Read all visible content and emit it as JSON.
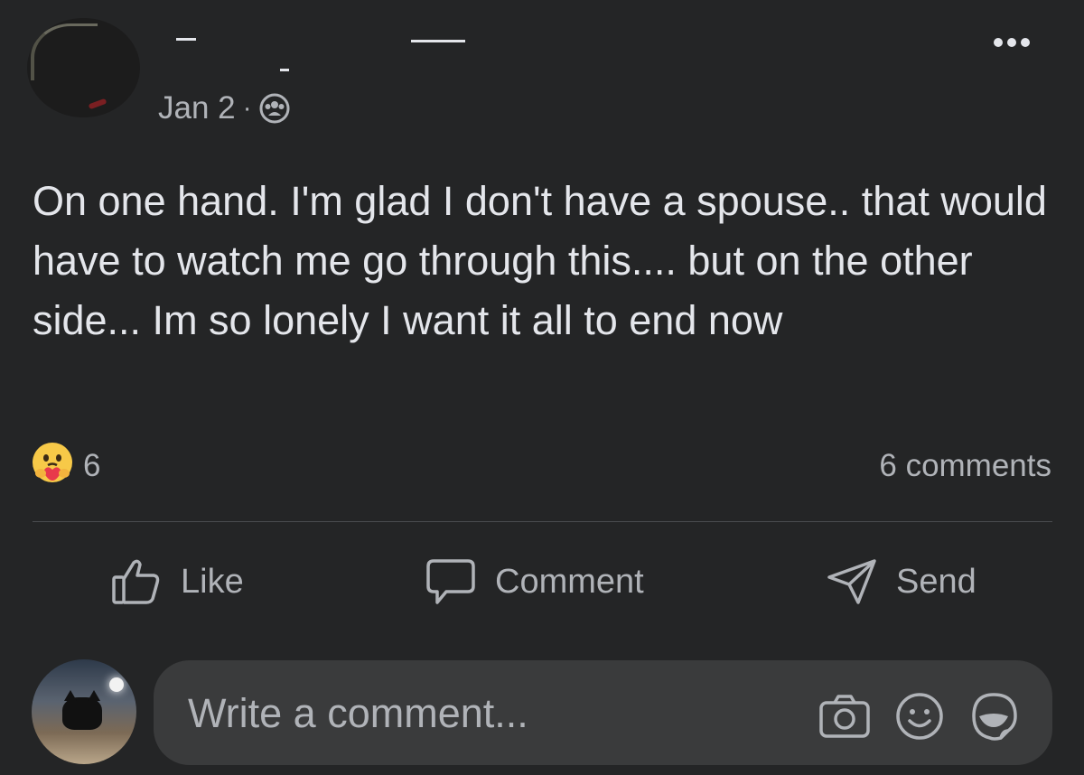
{
  "post": {
    "date": "Jan 2",
    "separator": "·",
    "audience_icon": "friends-icon",
    "text": "On one hand. I'm glad I don't have a spouse.. that would have to watch me go through this.... but on the other side... Im so lonely I want it all to end now",
    "reaction_icon": "care-reaction-icon",
    "reaction_count": "6",
    "comments_count": "6 comments"
  },
  "actions": {
    "like_label": "Like",
    "comment_label": "Comment",
    "send_label": "Send"
  },
  "composer": {
    "placeholder": "Write a comment..."
  },
  "colors": {
    "background": "#242526",
    "text": "#e4e6eb",
    "secondary_text": "#b0b3b8",
    "input_background": "#3a3b3c"
  }
}
